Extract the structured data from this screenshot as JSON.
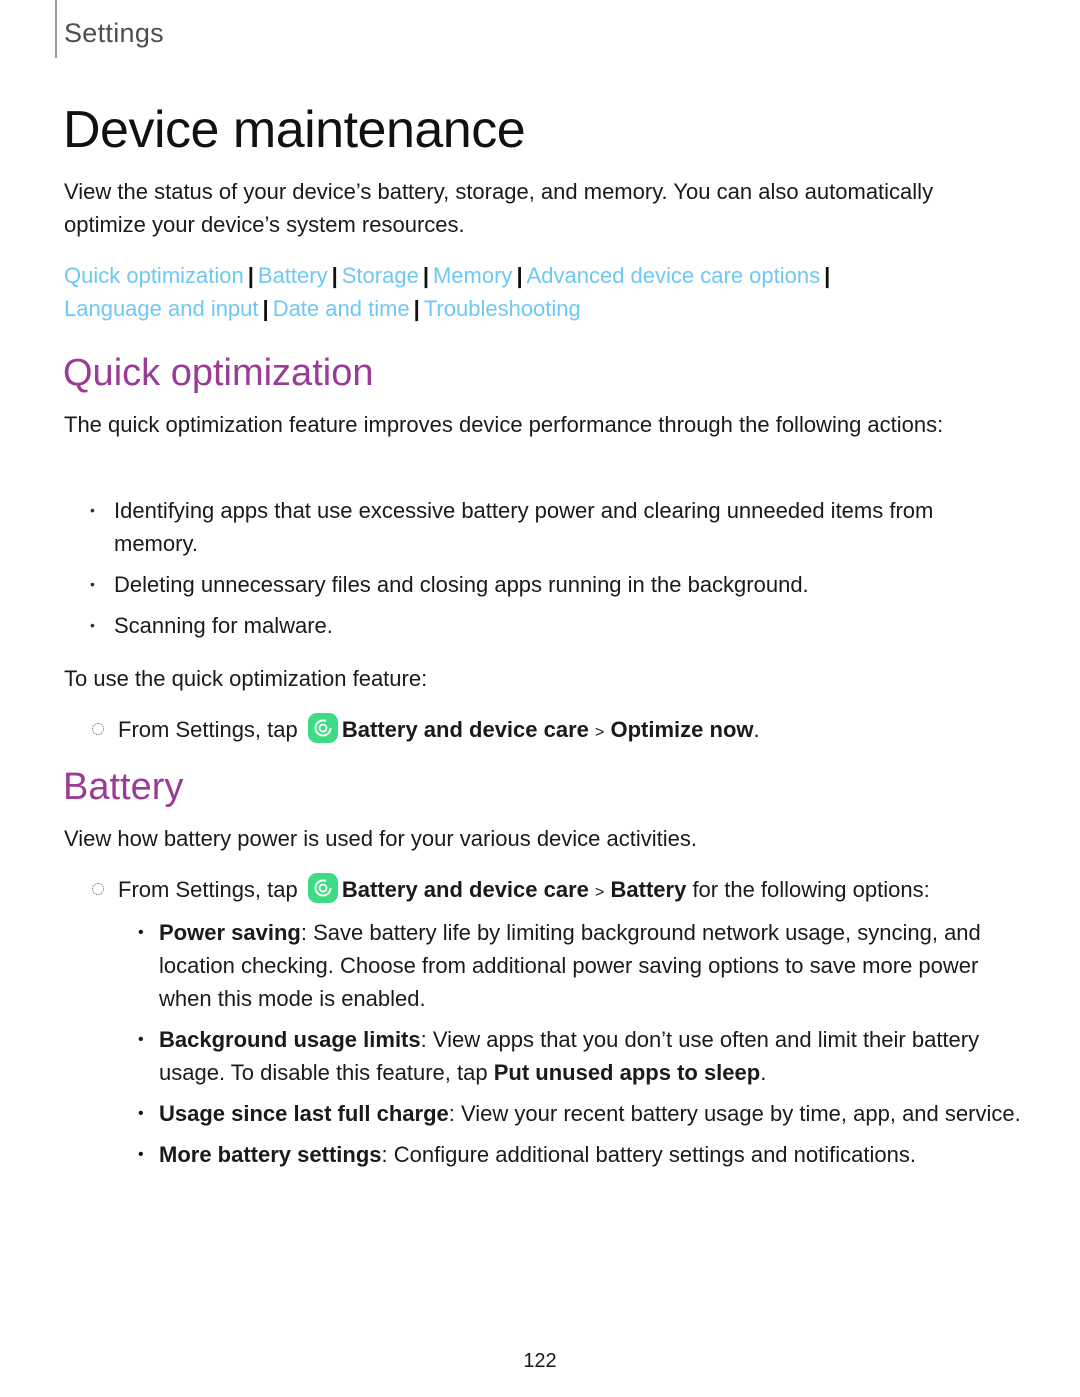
{
  "header": {
    "label": "Settings"
  },
  "page_title": "Device maintenance",
  "intro": "View the status of your device’s battery, storage, and memory. You can also automatically optimize your device’s system resources.",
  "links": [
    "Quick optimization",
    "Battery",
    "Storage",
    "Memory",
    "Advanced device care options",
    "Language and input",
    "Date and time",
    "Troubleshooting"
  ],
  "link_separator": "|",
  "colors": {
    "link": "#6fc7f5",
    "section_heading": "#9a3c96",
    "app_icon": "#3ddc84"
  },
  "quick_optimization": {
    "title": "Quick optimization",
    "description": "The quick optimization feature improves device performance through the following actions:",
    "actions": [
      "Identifying apps that use excessive battery power and clearing unneeded items from memory.",
      "Deleting unnecessary files and closing apps running in the background.",
      "Scanning for malware."
    ],
    "usage_intro": "To use the quick optimization feature:",
    "step": {
      "prefix": "From Settings, tap",
      "icon": "device-care-icon",
      "path1": "Battery and device care",
      "arrow": ">",
      "path2": "Optimize now",
      "suffix": "."
    }
  },
  "battery": {
    "title": "Battery",
    "description": "View how battery power is used for your various device activities.",
    "step": {
      "prefix": "From Settings, tap",
      "icon": "device-care-icon",
      "path1": "Battery and device care",
      "arrow": ">",
      "path2": "Battery",
      "suffix": "for the following options:"
    },
    "options": [
      {
        "term": "Power saving",
        "text": "Save battery life by limiting background network usage, syncing, and location checking. Choose from additional power saving options to save more power when this mode is enabled.",
        "bold_tail": "",
        "end": ""
      },
      {
        "term": "Background usage limits",
        "text": "View apps that you don’t use often and limit their battery usage. To disable this feature, tap",
        "bold_tail": "Put unused apps to sleep",
        "end": "."
      },
      {
        "term": "Usage since last full charge",
        "text": "View your recent battery usage by time, app, and service.",
        "bold_tail": "",
        "end": ""
      },
      {
        "term": "More battery settings",
        "text": "Configure additional battery settings and notifications.",
        "bold_tail": "",
        "end": ""
      }
    ]
  },
  "page_number": "122"
}
